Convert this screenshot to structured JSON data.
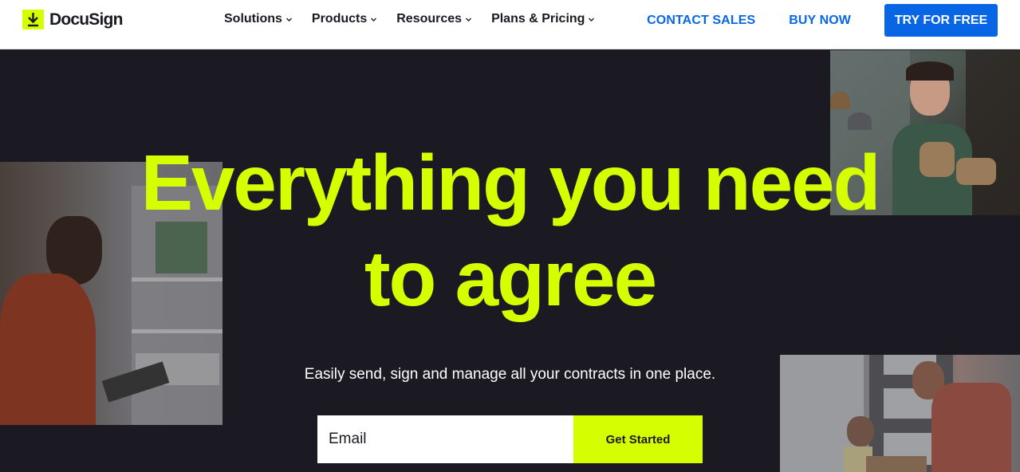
{
  "header": {
    "logo_text": "DocuSign",
    "nav": [
      {
        "label": "Solutions"
      },
      {
        "label": "Products"
      },
      {
        "label": "Resources"
      },
      {
        "label": "Plans & Pricing"
      }
    ],
    "contact_sales_label": "CONTACT SALES",
    "buy_now_label": "BUY NOW",
    "try_free_label": "TRY FOR FREE"
  },
  "hero": {
    "headline_line1": "Everything you need",
    "headline_line2": "to agree",
    "subtitle": "Easily send, sign and manage all your contracts in one place.",
    "email_placeholder": "Email",
    "cta_label": "Get Started"
  },
  "colors": {
    "accent": "#d5ff00",
    "primary_blue": "#0866e6",
    "background": "#1b1a23"
  }
}
